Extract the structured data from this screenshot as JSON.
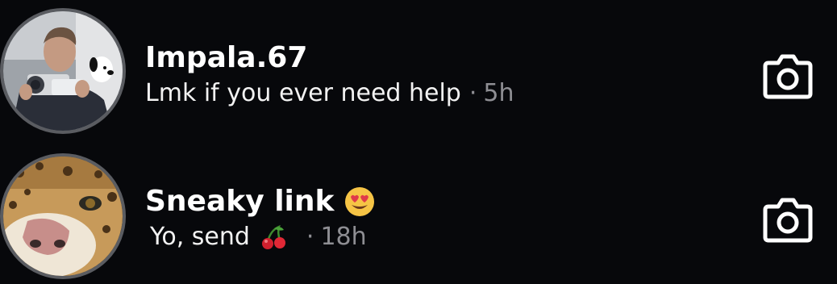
{
  "threads": [
    {
      "name": "Impala.67",
      "message": "Lmk if you ever need help",
      "separator": "·",
      "time": "5h",
      "avatar_icon": "avatar-person-with-camera",
      "action_icon": "camera-icon"
    },
    {
      "name": "Sneaky link",
      "name_emoji": "heart-eyes-emoji",
      "message": "Yo, send",
      "message_emoji": "cherries-emoji",
      "separator": "·",
      "time": "18h",
      "avatar_icon": "avatar-leopard",
      "action_icon": "camera-icon"
    }
  ],
  "colors": {
    "background": "#07080b",
    "text_primary": "#ffffff",
    "text_secondary": "#8e8e93",
    "avatar_ring": "#5a5c61"
  }
}
